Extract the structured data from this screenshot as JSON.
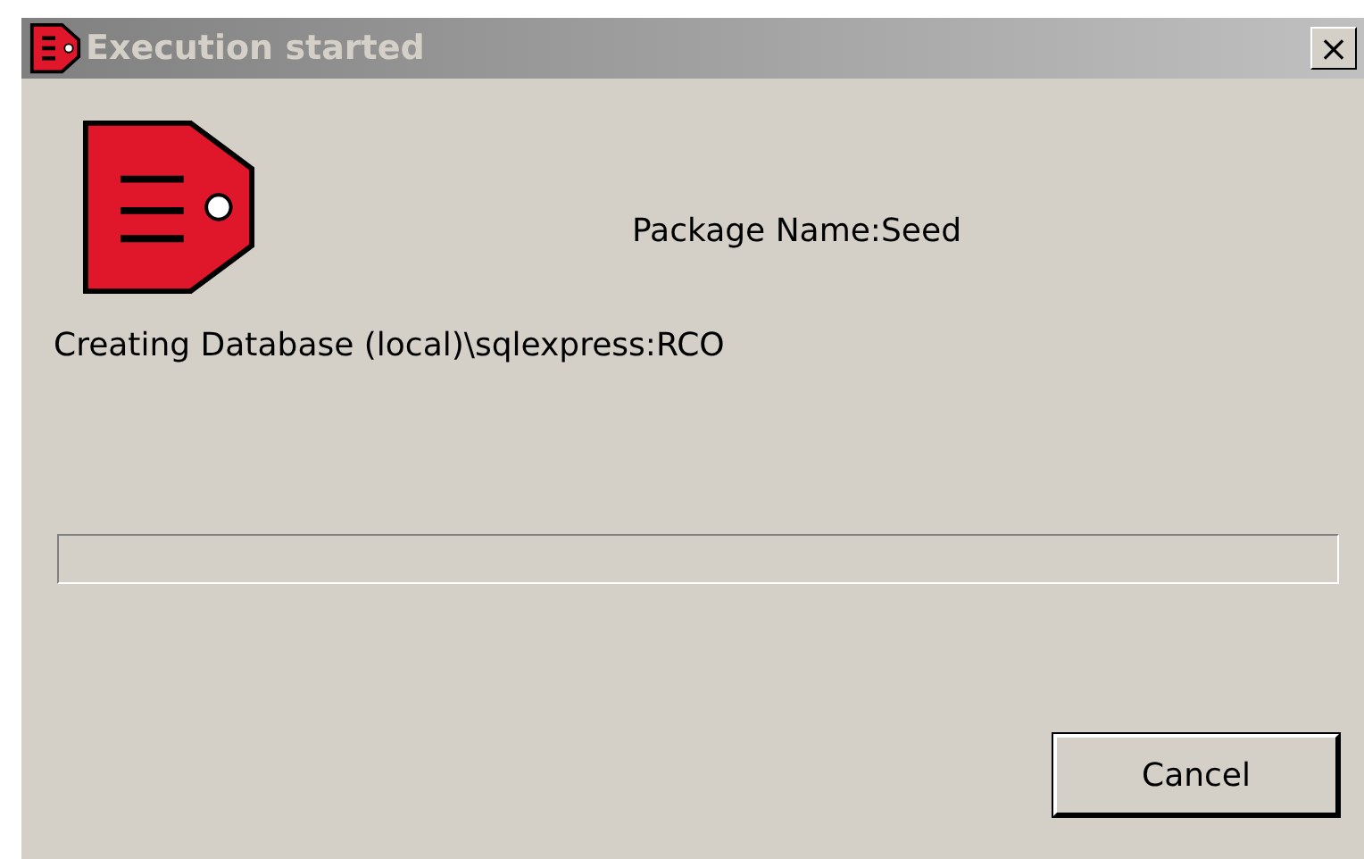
{
  "window": {
    "title": "Execution started",
    "close": "×"
  },
  "package_name": "Package Name:Seed",
  "status": "Creating Database (local)\\sqlexpress:RCO",
  "progress": {
    "level": 0
  },
  "buttons": [
    "Cancel"
  ]
}
